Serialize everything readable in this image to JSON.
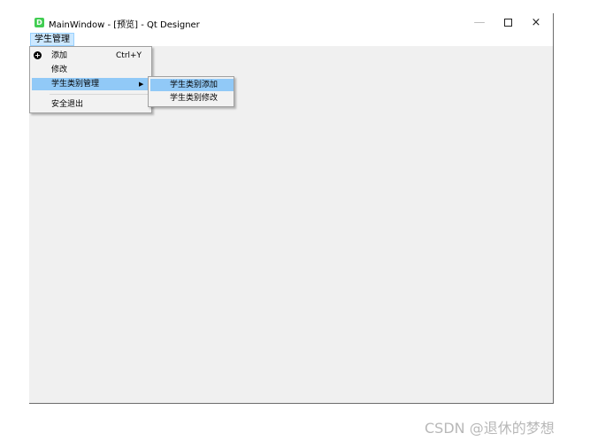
{
  "window": {
    "title": "MainWindow - [预览] - Qt Designer",
    "app_icon_letter": "D",
    "controls": {
      "minimize": "—",
      "close": "×"
    }
  },
  "menubar": {
    "items": [
      {
        "label": "学生管理"
      }
    ]
  },
  "menu": {
    "items": [
      {
        "label": "添加",
        "shortcut": "Ctrl+Y"
      },
      {
        "label": "修改"
      },
      {
        "label": "学生类别管理",
        "arrow": "▶"
      },
      {
        "label": "安全退出"
      }
    ]
  },
  "submenu": {
    "items": [
      {
        "label": "学生类别添加"
      },
      {
        "label": "学生类别修改"
      }
    ]
  },
  "watermark": "CSDN @退休的梦想",
  "colors": {
    "highlight": "#91c9f7",
    "menubar_active": "#cce8ff",
    "app_icon": "#41cd52"
  }
}
